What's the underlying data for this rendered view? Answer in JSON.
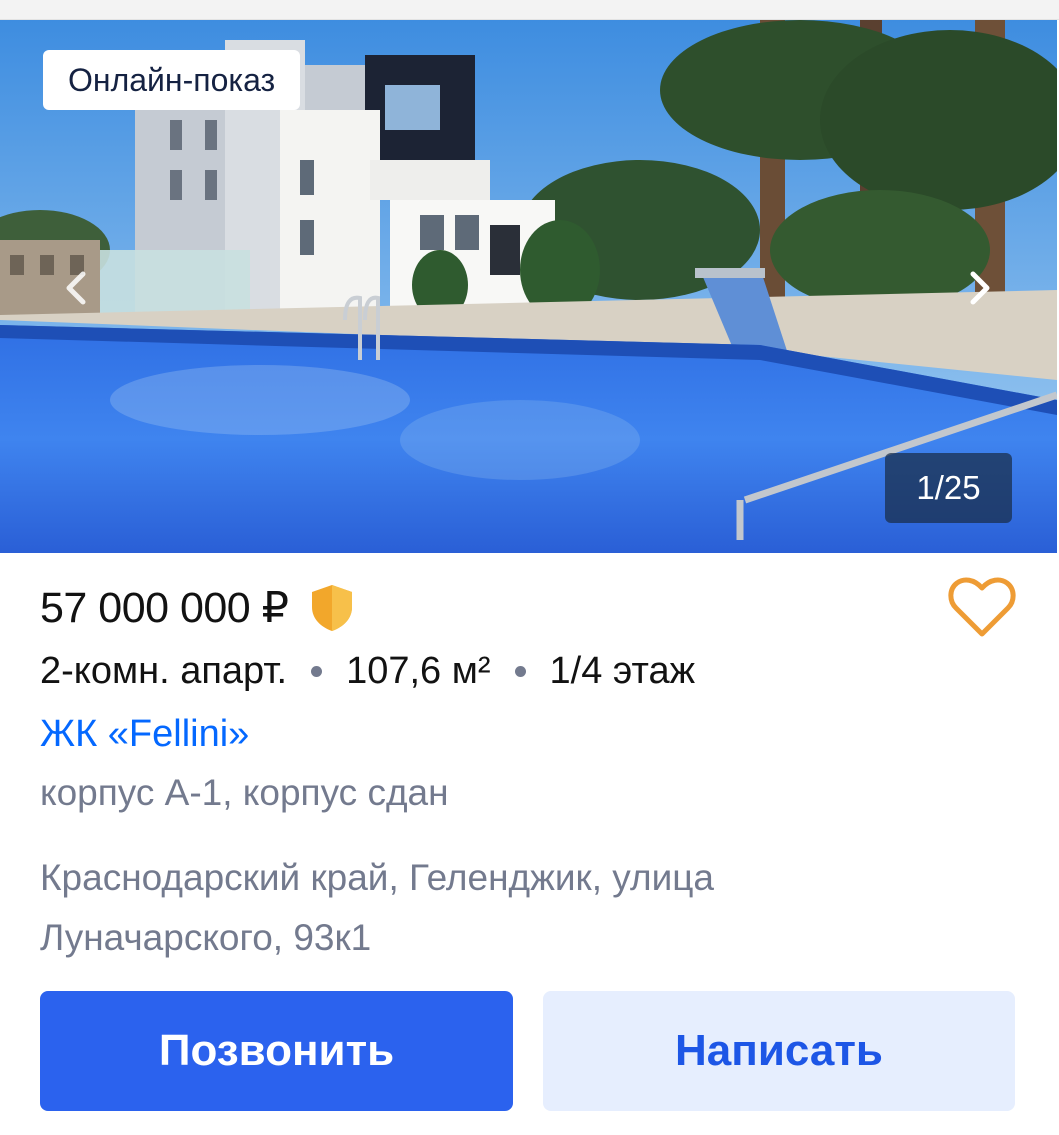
{
  "gallery": {
    "badge": "Онлайн-показ",
    "counter": "1/25",
    "current_photo": 1,
    "total_photos": 25,
    "prev_icon": "chevron-left-icon",
    "next_icon": "chevron-right-icon"
  },
  "listing": {
    "price": "57 000 000 ₽",
    "verified_icon": "shield-icon",
    "favorite_icon": "heart-outline-icon",
    "params": [
      "2-комн. апарт.",
      "107,6 м²",
      "1/4 этаж"
    ],
    "complex": "ЖК «Fellini»",
    "building": "корпус А-1, корпус сдан",
    "address": "Краснодарский край, Геленджик, улица Луначарского, 93к1"
  },
  "actions": {
    "call_label": "Позвонить",
    "write_label": "Написать"
  },
  "colors": {
    "primary": "#2b62ee",
    "link": "#0468ff",
    "secondary_text": "#737a8e",
    "favorite": "#ee9c35",
    "shield": "#f2a72b"
  }
}
